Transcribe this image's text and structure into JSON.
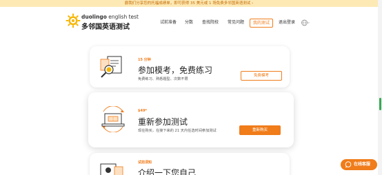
{
  "banner": {
    "text": "爵我们分享您的托福成绩单，即可获得 35 美元或 1 场免费多邻国英语测试 ›"
  },
  "header": {
    "logo_en_bold": "duolingo",
    "logo_en_lite": " english test",
    "logo_cn": "多邻国英语测试",
    "nav": [
      {
        "label": "试前准备"
      },
      {
        "label": "分数"
      },
      {
        "label": "查找院校"
      },
      {
        "label": "常见问题"
      },
      {
        "label": "我的测试"
      },
      {
        "label": "退出登录"
      }
    ]
  },
  "cards": [
    {
      "tag": "15 分钟",
      "title": "参加模考，免费练习",
      "desc": "免费练习、熟悉题型、次数不限",
      "button": "免费模考"
    },
    {
      "tag": "$49*",
      "title": "重新参加测试",
      "desc": "现在购买，在接下来的 21 天内任选时间参加测试",
      "button": "重新购买"
    },
    {
      "tag": "试前须知",
      "title": "介绍一下您自己"
    }
  ],
  "chat": {
    "label": "在线客服"
  },
  "colors": {
    "accent": "#f07c1a",
    "banner_bg": "#fde9b4",
    "scroll_thumb": "#36a853"
  },
  "icons": [
    "duolingo-logo-icon",
    "globe-icon",
    "chevron-down-icon",
    "magnifier-document-icon",
    "laptop-ticket-icon",
    "profile-card-icon",
    "chat-bubble-icon"
  ]
}
